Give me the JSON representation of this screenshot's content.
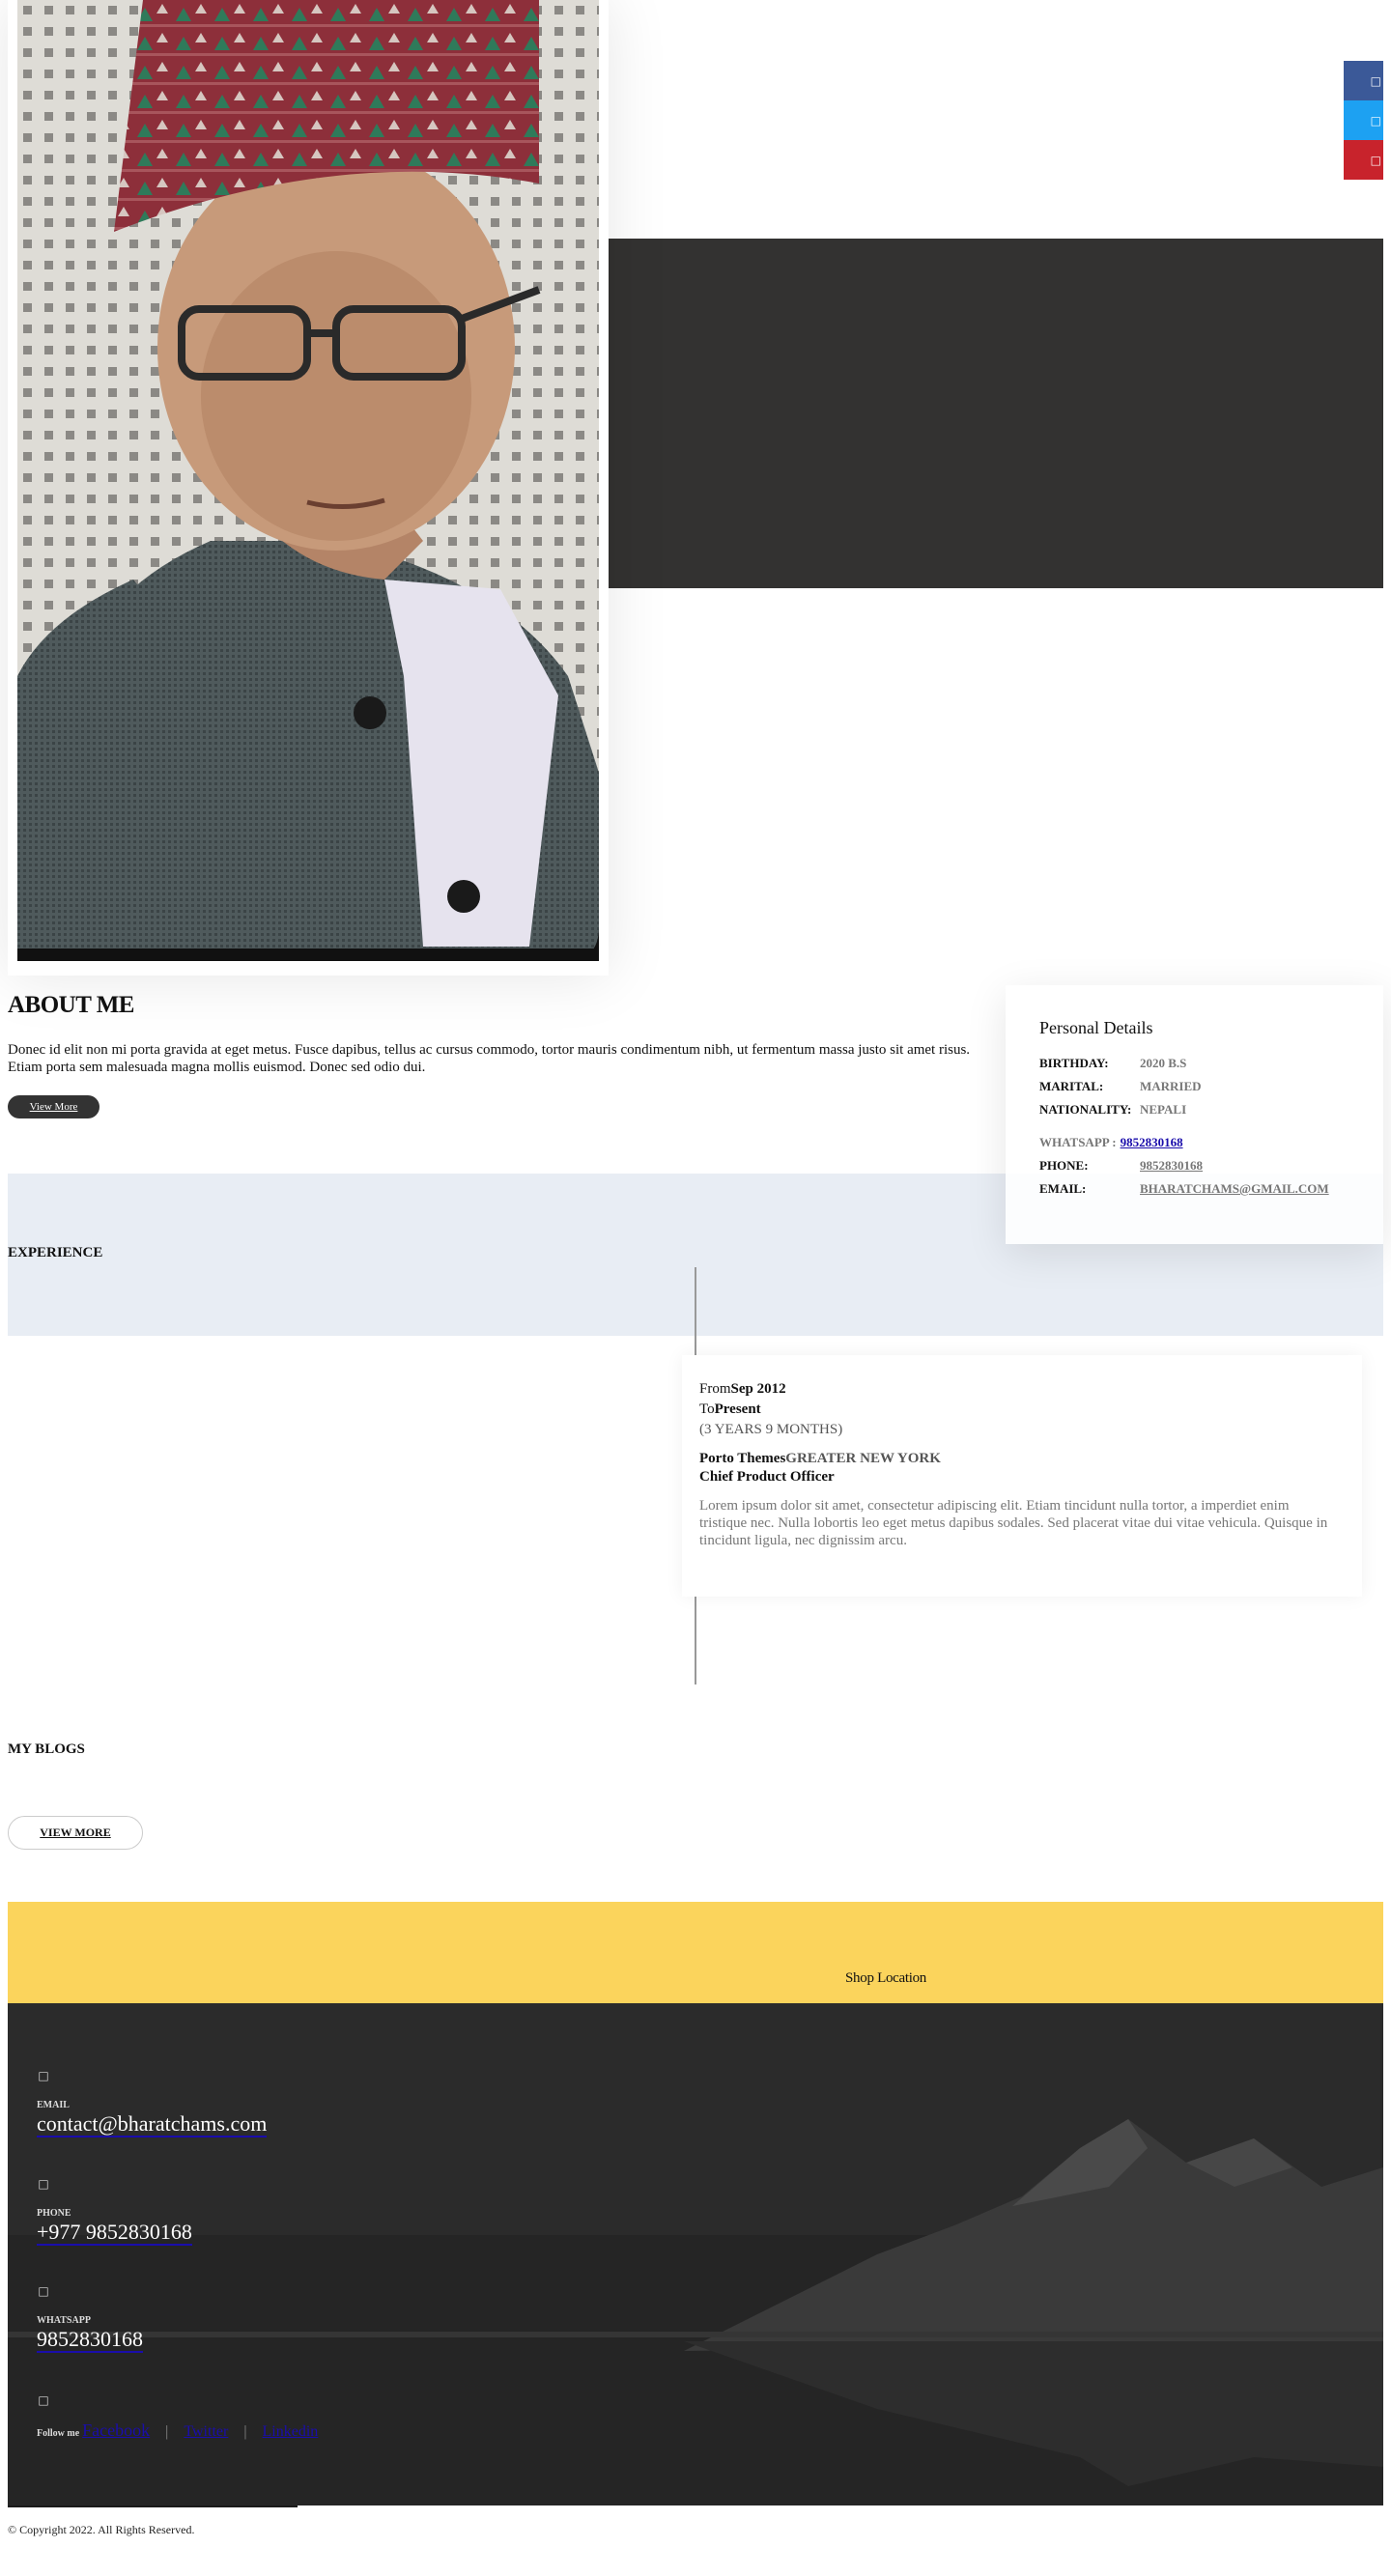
{
  "social": {
    "facebook_icon": "facebook-icon",
    "twitter_icon": "twitter-icon",
    "pinterest_icon": "pinterest-icon",
    "colors": {
      "facebook": "#3b5998",
      "twitter": "#1da1f2",
      "pinterest": "#c8232c"
    }
  },
  "about": {
    "title": "ABOUT ME",
    "text": "Donec id elit non mi porta gravida at eget metus. Fusce dapibus, tellus ac cursus commodo, tortor mauris condimentum nibh, ut fermentum massa justo sit amet risus. Etiam porta sem malesuada magna mollis euismod. Donec sed odio dui.",
    "button_label": "View More"
  },
  "personal_details": {
    "title": "Personal Details",
    "birthday_key": "BIRTHDAY:",
    "birthday_val": "2020 B.S",
    "marital_key": "MARITAL:",
    "marital_val": "MARRIED",
    "nationality_key": "NATIONALITY:",
    "nationality_val": "NEPALI",
    "whatsapp_key": "WHATSAPP :",
    "whatsapp_val": "9852830168",
    "phone_key": "PHONE:",
    "phone_val": "9852830168",
    "email_key": "EMAIL:",
    "email_val": "BHARATCHAMS@GMAIL.COM"
  },
  "experience": {
    "title": "EXPERIENCE",
    "from_label": "From",
    "from_val": "Sep 2012",
    "to_label": "To",
    "to_val": "Present",
    "duration": "(3 YEARS 9 MONTHS)",
    "company": "Porto Themes",
    "location": "GREATER NEW YORK",
    "role": "Chief Product Officer",
    "description": "Lorem ipsum dolor sit amet, consectetur adipiscing elit. Etiam tincidunt nulla tortor, a imperdiet enim tristique nec. Nulla lobortis leo eget metus dapibus sodales. Sed placerat vitae dui vitae vehicula. Quisque in tincidunt ligula, nec dignissim arcu."
  },
  "blogs": {
    "title": "MY BLOGS",
    "button_label": "VIEW MORE"
  },
  "shop": {
    "label": "Shop Location"
  },
  "footer": {
    "email_label": "EMAIL",
    "email_value": "contact@bharatchams.com",
    "phone_label": "PHONE",
    "phone_value": "+977 9852830168",
    "whatsapp_label": "WHATSAPP",
    "whatsapp_value": "9852830168",
    "follow_label": "Follow me",
    "follow_links": [
      "Facebook",
      "Twitter",
      "Linkedin"
    ]
  },
  "copyright": "© Copyright 2022. All Rights Reserved."
}
